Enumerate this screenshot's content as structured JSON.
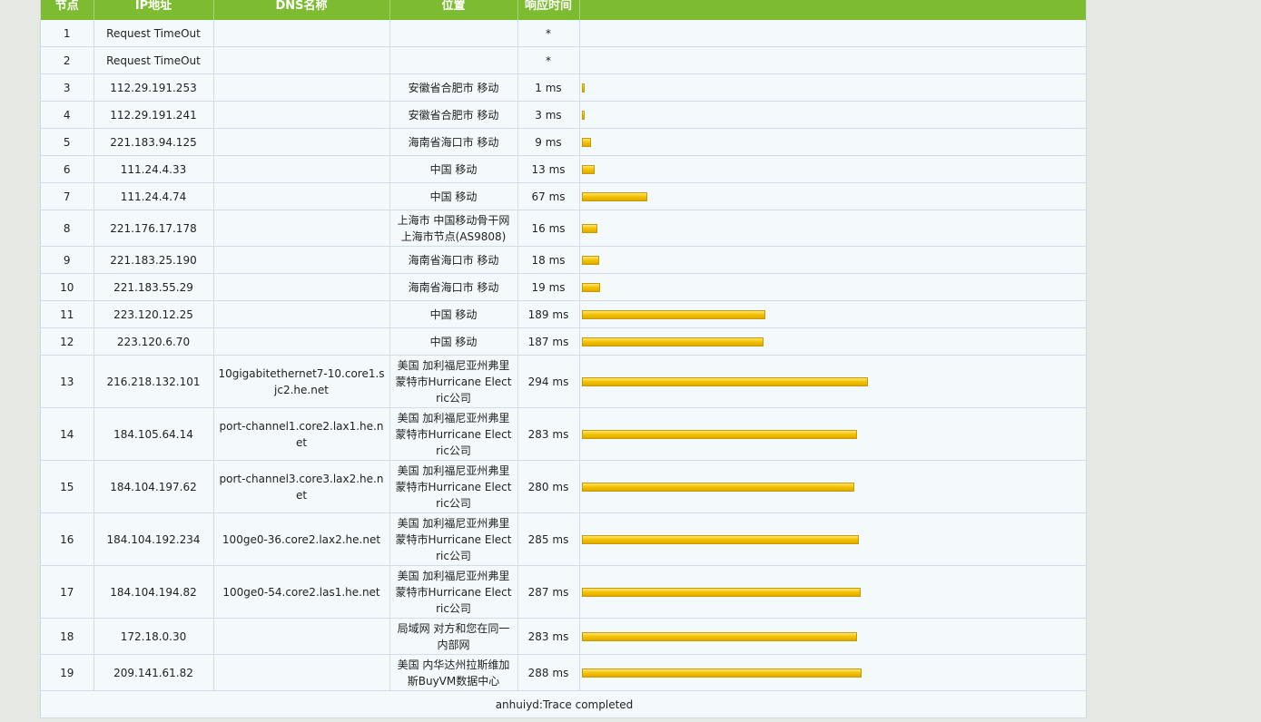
{
  "table": {
    "headers": [
      "节点",
      "IP地址",
      "DNS名称",
      "位置",
      "响应时间",
      ""
    ],
    "rows": [
      {
        "hop": "1",
        "ip": "Request TimeOut",
        "dns": "",
        "loc": "",
        "time": "*",
        "ms": 0
      },
      {
        "hop": "2",
        "ip": "Request TimeOut",
        "dns": "",
        "loc": "",
        "time": "*",
        "ms": 0
      },
      {
        "hop": "3",
        "ip": "112.29.191.253",
        "dns": "",
        "loc": "安徽省合肥市 移动",
        "time": "1 ms",
        "ms": 1
      },
      {
        "hop": "4",
        "ip": "112.29.191.241",
        "dns": "",
        "loc": "安徽省合肥市 移动",
        "time": "3 ms",
        "ms": 3
      },
      {
        "hop": "5",
        "ip": "221.183.94.125",
        "dns": "",
        "loc": "海南省海口市 移动",
        "time": "9 ms",
        "ms": 9
      },
      {
        "hop": "6",
        "ip": "111.24.4.33",
        "dns": "",
        "loc": "中国 移动",
        "time": "13 ms",
        "ms": 13
      },
      {
        "hop": "7",
        "ip": "111.24.4.74",
        "dns": "",
        "loc": "中国 移动",
        "time": "67 ms",
        "ms": 67
      },
      {
        "hop": "8",
        "ip": "221.176.17.178",
        "dns": "",
        "loc": "上海市 中国移动骨干网上海市节点(AS9808)",
        "time": "16 ms",
        "ms": 16
      },
      {
        "hop": "9",
        "ip": "221.183.25.190",
        "dns": "",
        "loc": "海南省海口市 移动",
        "time": "18 ms",
        "ms": 18
      },
      {
        "hop": "10",
        "ip": "221.183.55.29",
        "dns": "",
        "loc": "海南省海口市 移动",
        "time": "19 ms",
        "ms": 19
      },
      {
        "hop": "11",
        "ip": "223.120.12.25",
        "dns": "",
        "loc": "中国 移动",
        "time": "189 ms",
        "ms": 189
      },
      {
        "hop": "12",
        "ip": "223.120.6.70",
        "dns": "",
        "loc": "中国 移动",
        "time": "187 ms",
        "ms": 187
      },
      {
        "hop": "13",
        "ip": "216.218.132.101",
        "dns": "10gigabitethernet7-10.core1.sjc2.he.net",
        "loc": "美国 加利福尼亚州弗里蒙特市Hurricane Electric公司",
        "time": "294 ms",
        "ms": 294
      },
      {
        "hop": "14",
        "ip": "184.105.64.14",
        "dns": "port-channel1.core2.lax1.he.net",
        "loc": "美国 加利福尼亚州弗里蒙特市Hurricane Electric公司",
        "time": "283 ms",
        "ms": 283
      },
      {
        "hop": "15",
        "ip": "184.104.197.62",
        "dns": "port-channel3.core3.lax2.he.net",
        "loc": "美国 加利福尼亚州弗里蒙特市Hurricane Electric公司",
        "time": "280 ms",
        "ms": 280
      },
      {
        "hop": "16",
        "ip": "184.104.192.234",
        "dns": "100ge0-36.core2.lax2.he.net",
        "loc": "美国 加利福尼亚州弗里蒙特市Hurricane Electric公司",
        "time": "285 ms",
        "ms": 285
      },
      {
        "hop": "17",
        "ip": "184.104.194.82",
        "dns": "100ge0-54.core2.las1.he.net",
        "loc": "美国 加利福尼亚州弗里蒙特市Hurricane Electric公司",
        "time": "287 ms",
        "ms": 287
      },
      {
        "hop": "18",
        "ip": "172.18.0.30",
        "dns": "",
        "loc": "局域网 对方和您在同一内部网",
        "time": "283 ms",
        "ms": 283
      },
      {
        "hop": "19",
        "ip": "209.141.61.82",
        "dns": "",
        "loc": "美国 内华达州拉斯维加斯BuyVM数据中心",
        "time": "288 ms",
        "ms": 288
      }
    ],
    "footer": "anhuiyd:Trace completed"
  },
  "colors": {
    "header_bg": "#7dbc30",
    "bar": "#f5c400",
    "row_bg": "#f4f9fb"
  }
}
